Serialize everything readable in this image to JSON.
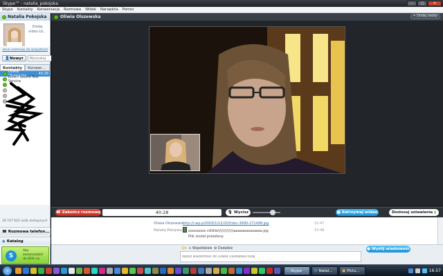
{
  "window": {
    "title": "Skype™ - natalia_pokojska",
    "controls": [
      "–",
      "□",
      "✕"
    ]
  },
  "menu": [
    "Skype",
    "Kontakty",
    "Konwersacja",
    "Rozmowa",
    "Widok",
    "Narzędzia",
    "Pomoc"
  ],
  "sidebar": {
    "user_name": "Natalia Pokojska",
    "avatar_text": "Dodaj video Lb...",
    "shortcut_link": "Tanie rozmowy do wszystkich...",
    "new_button": "Nowy",
    "search_placeholder": "Wyszukaj",
    "tabs": [
      "Kontakty",
      "Konwer..."
    ],
    "contacts": [
      {
        "name": "Oliwia Olszewska",
        "time": "40:28",
        "selected": true
      },
      {
        "name": "Echo / Sound Test Service",
        "time": "",
        "selected": false
      },
      {
        "name": "",
        "time": "",
        "selected": false
      },
      {
        "name": "",
        "time": "",
        "selected": false
      },
      {
        "name": "",
        "time": "",
        "selected": false
      },
      {
        "name": "",
        "time": "",
        "selected": false
      }
    ],
    "online_count": "18 747 622 osób dostępnych",
    "call_phones": "Rozmowa telefon...",
    "catalog": "Katalog",
    "promo_text": [
      "Aby",
      "zaoszczędzić",
      "do 60% na"
    ]
  },
  "call": {
    "contact": "Oliwia Olszewska",
    "add_people": "+ Dodaj osoby",
    "end_call": "Zakończ rozmowę",
    "timer": "40:28",
    "mute": "Wycisz",
    "stop_video": "Zatrzymaj wideo",
    "settings": "Dostosuj ustawienia",
    "volume_level": 0.6
  },
  "chat": {
    "messages": [
      {
        "sender": "Oliwia Olszewska",
        "text": "http://i.wp.pl/00/0/1/12/20/f/doc-3690-271498.jpg",
        "time": "15:47",
        "link": true
      },
      {
        "sender": "Natalia Pokojska",
        "text": "Plik został przesłany.",
        "time": "15:48",
        "link": false
      }
    ],
    "file_name": "zzzzzzzzzz cillilllie\\\\\\\\\\\\\\\\\\\\\\\\\\\\aaaaaaaaaaaaaa.jpg"
  },
  "composer": {
    "share": "Współdziel",
    "add": "Dodatki",
    "placeholder": "Wpisz wiadomość do Oliwia Olszewska tutaj",
    "send": "Wyślij wiadomość"
  },
  "taskbar": {
    "tasks": [
      {
        "label": "Skype",
        "active": true
      },
      {
        "label": "Natal...",
        "active": false
      },
      {
        "label": "Pictu...",
        "active": false
      }
    ],
    "clock": "16:57"
  },
  "colors": {
    "accent": "#1e8fd8",
    "end_call": "#c72d1d",
    "online": "#5fc21c",
    "selected": "#3d8fd8"
  }
}
